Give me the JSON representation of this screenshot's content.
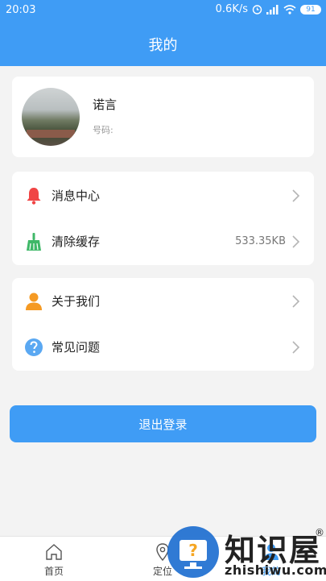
{
  "status_bar": {
    "time": "20:03",
    "network_speed": "0.6K/s",
    "battery": "91"
  },
  "header": {
    "title": "我的"
  },
  "profile": {
    "name": "诺言",
    "phone_label": "号码:"
  },
  "menu_group_1": [
    {
      "label": "消息中心",
      "value": "",
      "icon": "bell-icon"
    },
    {
      "label": "清除缓存",
      "value": "533.35KB",
      "icon": "broom-icon"
    }
  ],
  "menu_group_2": [
    {
      "label": "关于我们",
      "value": "",
      "icon": "person-icon"
    },
    {
      "label": "常见问题",
      "value": "",
      "icon": "question-icon"
    }
  ],
  "logout": {
    "label": "退出登录"
  },
  "tabbar": {
    "items": [
      {
        "label": "首页",
        "icon": "home-icon"
      },
      {
        "label": "定位",
        "icon": "location-icon"
      },
      {
        "label": "我的",
        "icon": "user-icon"
      }
    ]
  },
  "watermark": {
    "title": "知识屋",
    "reg": "®",
    "url": "zhishiwu.com"
  },
  "colors": {
    "primary": "#3f9cf5",
    "bell": "#f04545",
    "broom": "#3fb868",
    "person": "#f59a23",
    "question": "#5aa8f2"
  }
}
